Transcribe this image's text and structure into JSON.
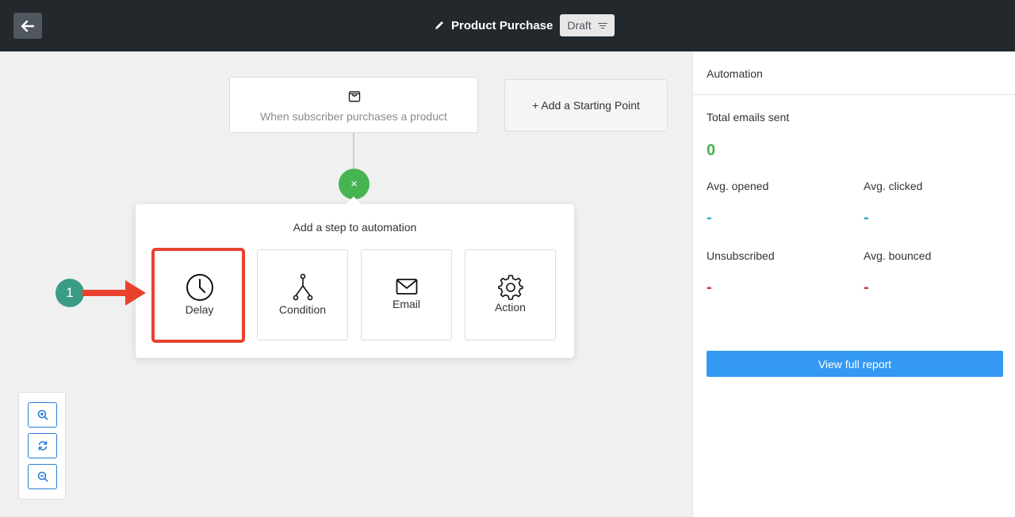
{
  "header": {
    "title": "Product Purchase",
    "status": "Draft"
  },
  "canvas": {
    "trigger": {
      "label": "When subscriber purchases a product",
      "icon": "shopping-bag-icon"
    },
    "add_starting_point": "+ Add a Starting Point",
    "close_icon": "×",
    "popover": {
      "heading": "Add a step to automation",
      "steps": [
        {
          "label": "Delay",
          "icon": "clock-icon"
        },
        {
          "label": "Condition",
          "icon": "branch-icon"
        },
        {
          "label": "Email",
          "icon": "envelope-icon"
        },
        {
          "label": "Action",
          "icon": "gear-icon"
        }
      ]
    },
    "annotation_number": "1",
    "zoom_controls": [
      "zoom-in-icon",
      "reset-icon",
      "zoom-out-icon"
    ]
  },
  "sidebar": {
    "title": "Automation",
    "total_emails_label": "Total emails sent",
    "total_emails_value": "0",
    "avg_opened_label": "Avg. opened",
    "avg_opened_value": "-",
    "avg_clicked_label": "Avg. clicked",
    "avg_clicked_value": "-",
    "unsubscribed_label": "Unsubscribed",
    "unsubscribed_value": "-",
    "avg_bounced_label": "Avg. bounced",
    "avg_bounced_value": "-",
    "report_button": "View full report"
  },
  "colors": {
    "topbar": "#23282d",
    "accent_green": "#46b450",
    "accent_blue": "#3399f3",
    "highlight_red": "#e8422f",
    "badge_teal": "#3a9c87"
  }
}
